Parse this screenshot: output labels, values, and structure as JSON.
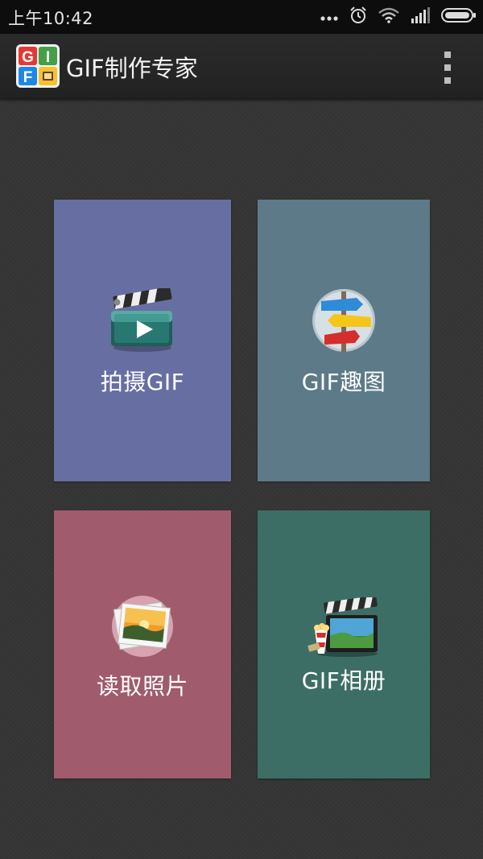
{
  "status_bar": {
    "time": "上午10:42",
    "icons": [
      "more-dots-icon",
      "alarm-icon",
      "wifi-icon",
      "signal-icon",
      "battery-icon"
    ]
  },
  "action_bar": {
    "title": "GIF制作专家",
    "logo_letters": [
      "G",
      "I",
      "F"
    ],
    "menu_icon": "overflow-menu-icon"
  },
  "tiles": [
    {
      "label": "拍摄GIF",
      "icon": "clapperboard-play-icon",
      "color": "#676ea1"
    },
    {
      "label": "GIF趣图",
      "icon": "signpost-icon",
      "color": "#5d7a88"
    },
    {
      "label": "读取照片",
      "icon": "photo-stack-icon",
      "color": "#a05b6c"
    },
    {
      "label": "GIF相册",
      "icon": "film-album-icon",
      "color": "#3d6e65"
    }
  ],
  "colors": {
    "background": "#353535",
    "status_bar": "#0d0d0d",
    "action_bar": "#262626"
  }
}
